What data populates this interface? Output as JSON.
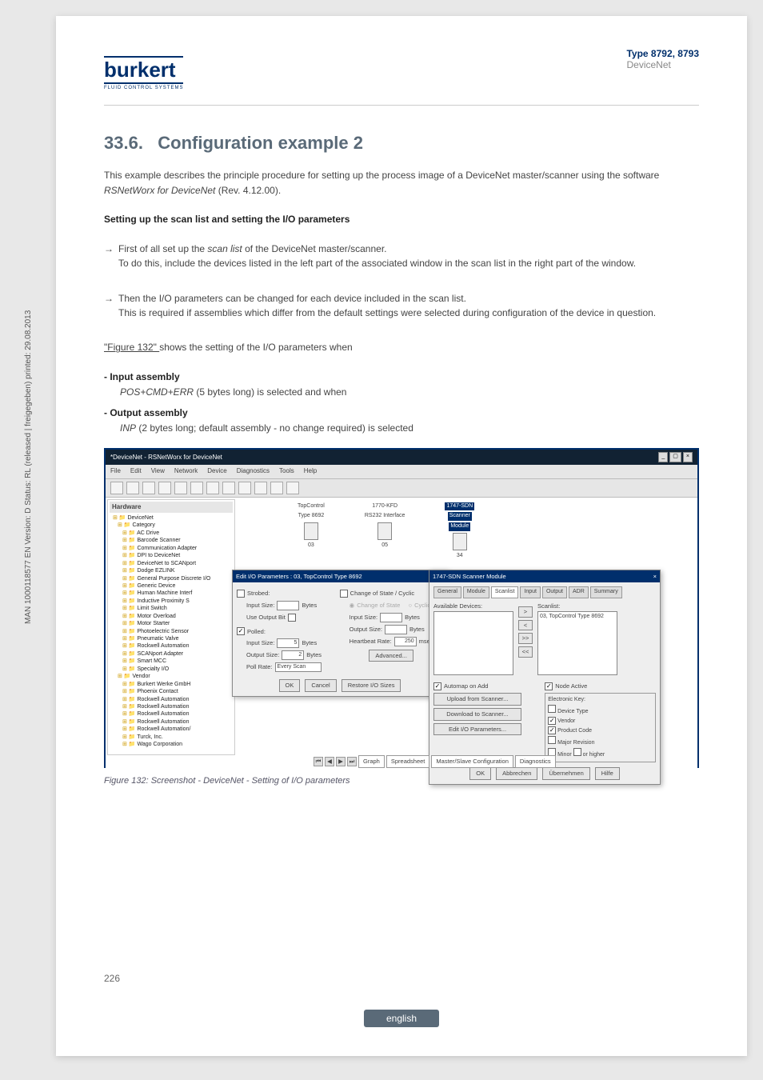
{
  "header": {
    "type": "Type 8792, 8793",
    "subtitle": "DeviceNet",
    "logo_text": "burkert",
    "logo_sub": "FLUID CONTROL SYSTEMS"
  },
  "sidebar": "MAN 1000118577 EN Version: D Status: RL (released | freigegeben) printed: 29.08.2013",
  "section": {
    "num": "33.6.",
    "title": "Configuration example 2"
  },
  "intro": "This example describes the principle procedure for setting up the process image of a DeviceNet master/scanner using the software ",
  "intro_italic": "RSNetWorx for DeviceNet",
  "intro_tail": " (Rev. 4.12.00).",
  "h_scanlist": "Setting up the scan list and setting the I/O parameters",
  "step1_lead": "First of all set up the ",
  "step1_italic": "scan list",
  "step1_tail": " of the DeviceNet master/scanner.",
  "step1_body": "To do this, include the devices listed in the left part of the associated window in the scan list in the right part of the window.",
  "step2_lead": "Then the I/O parameters can be changed for each device included in the scan list.",
  "step2_body": "This is required if assemblies which differ from the default settings were selected during configuration of the device in question.",
  "fig_lead": "\"Figure 132\" ",
  "fig_lead_tail": "shows the setting of the I/O parameters when",
  "input_asm": "- Input assembly",
  "input_asm_body_italic": "POS+CMD+ERR",
  "input_asm_body_tail": " (5 bytes long) is selected and when",
  "output_asm": "- Output assembly",
  "output_asm_body_italic": "INP",
  "output_asm_body_tail": " (2 bytes long; default assembly - no change required) is selected",
  "win": {
    "title": "*DeviceNet - RSNetWorx for DeviceNet",
    "menu": [
      "File",
      "Edit",
      "View",
      "Network",
      "Device",
      "Diagnostics",
      "Tools",
      "Help"
    ],
    "hw_title": "Hardware",
    "tree": [
      "DeviceNet",
      " Category",
      "  AC Drive",
      "  Barcode Scanner",
      "  Communication Adapter",
      "  DPI to DeviceNet",
      "  DeviceNet to SCANport",
      "  Dodge EZLINK",
      "  General Purpose Discrete I/O",
      "  Generic Device",
      "  Human Machine Interf",
      "  Inductive Proximity S",
      "  Limit Switch",
      "  Motor Overload",
      "  Motor Starter",
      "  Photoelectric Sensor",
      "  Pneumatic Valve",
      "  Rockwell Automation",
      "  SCANport Adapter",
      "  Smart MCC",
      "  Specialty I/O",
      " Vendor",
      "  Burkert Werke GmbH",
      "  Phoenix Contact",
      "  Rockwell Automation",
      "  Rockwell Automation",
      "  Rockwell Automation",
      "  Rockwell Automation",
      "  Rockwell Automation/",
      "  Turck, Inc.",
      "  Wago Corporation"
    ],
    "nodes": [
      {
        "t1": "TopControl",
        "t2": "Type 8692",
        "n": "03"
      },
      {
        "t1": "1770-KFD",
        "t2": "RS232 Interface",
        "n": "05"
      },
      {
        "t1": "1747-SDN",
        "t2": "Scanner",
        "t3": "Module",
        "n": "34",
        "sel": true
      }
    ],
    "dlg1": {
      "title": "Edit I/O Parameters : 03, TopControl Type 8692",
      "strobed": "Strobed:",
      "use_output": "Use Output Bit",
      "input_size": "Input Size:",
      "bytes": "Bytes",
      "cos": "Change of State / Cyclic",
      "cos_r": "Change of State",
      "cyc_r": "Cyclic",
      "output_size": "Output Size:",
      "polled": "Polled:",
      "hb": "Heartbeat Rate:",
      "msec": "msec",
      "poll_rate": "Poll Rate:",
      "poll_val": "Every Scan",
      "in_val": "5",
      "out_val": "2",
      "hb_val": "250",
      "adv": "Advanced...",
      "ok": "OK",
      "cancel": "Cancel",
      "restore": "Restore I/O Sizes"
    },
    "dlg2": {
      "title": "1747-SDN Scanner Module",
      "tabs": [
        "General",
        "Module",
        "Scanlist",
        "Input",
        "Output",
        "ADR",
        "Summary"
      ],
      "avail": "Available Devices:",
      "scanlist": "Scanlist:",
      "item": "03, TopControl Type 8692",
      "automap": "Automap on Add",
      "node_active": "Node Active",
      "upload": "Upload from Scanner...",
      "download": "Download to Scanner...",
      "edit": "Edit I/O Parameters...",
      "ekey": "Electronic Key:",
      "dt": "Device Type",
      "vend": "Vendor",
      "pc": "Product Code",
      "mr": "Major Revision",
      "min": "Minor",
      "high": "or higher",
      "ok": "OK",
      "abbr": "Abbrechen",
      "ubern": "Übernehmen",
      "hilfe": "Hilfe"
    },
    "sheet": {
      "tabs": [
        "Graph",
        "Spreadsheet",
        "Master/Slave Configuration",
        "Diagnostics"
      ]
    }
  },
  "fig_caption": "Figure 132:    Screenshot - DeviceNet - Setting of I/O parameters",
  "page_num": "226",
  "lang": "english"
}
